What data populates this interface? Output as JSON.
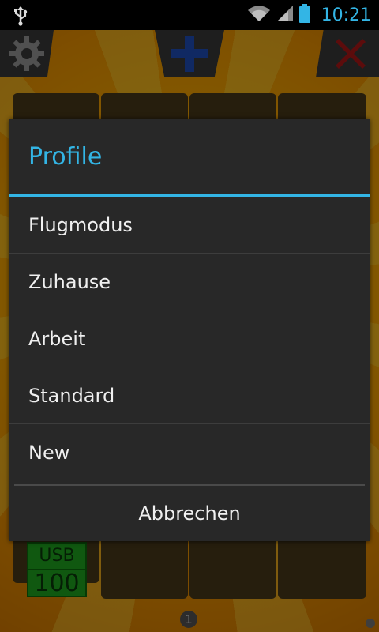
{
  "status_bar": {
    "time": "10:21",
    "time_color": "#33b5e5",
    "icons": [
      "usb-icon",
      "wifi-icon",
      "signal-icon",
      "battery-icon"
    ]
  },
  "app": {
    "toolbar": {
      "settings_icon": "gear-icon",
      "add_icon": "plus-icon",
      "close_icon": "close-icon"
    },
    "usb_badge": {
      "label": "USB",
      "value": "100"
    },
    "page_indicator": "1"
  },
  "dialog": {
    "title": "Profile",
    "accent_color": "#33b5e5",
    "items": [
      {
        "label": "Flugmodus"
      },
      {
        "label": "Zuhause"
      },
      {
        "label": "Arbeit"
      },
      {
        "label": "Standard"
      },
      {
        "label": "New"
      }
    ],
    "cancel_label": "Abbrechen"
  }
}
